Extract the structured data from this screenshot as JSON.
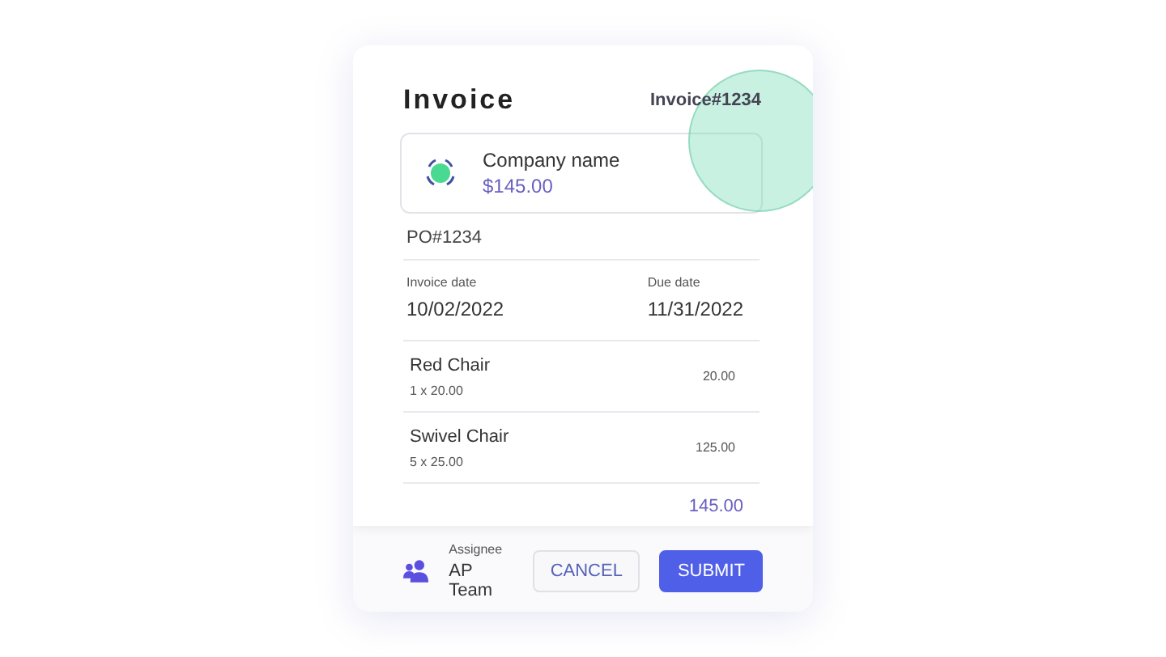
{
  "invoice": {
    "title": "Invoice",
    "number": "Invoice#1234",
    "company": {
      "name": "Company name",
      "amount": "$145.00"
    },
    "po": "PO#1234",
    "dates": [
      {
        "label": "Invoice date",
        "value": "10/02/2022"
      },
      {
        "label": "Due date",
        "value": "11/31/2022"
      }
    ],
    "items": [
      {
        "name": "Red Chair",
        "detail": "1 x 20.00",
        "amount": "20.00"
      },
      {
        "name": "Swivel Chair",
        "detail": "5 x 25.00",
        "amount": "125.00"
      }
    ],
    "total": "145.00"
  },
  "footer": {
    "assignee_label": "Assignee",
    "assignee": "AP Team",
    "buttons": [
      {
        "kind": "secondary",
        "label": "CANCEL"
      },
      {
        "kind": "primary",
        "label": "SUBMIT"
      }
    ]
  }
}
